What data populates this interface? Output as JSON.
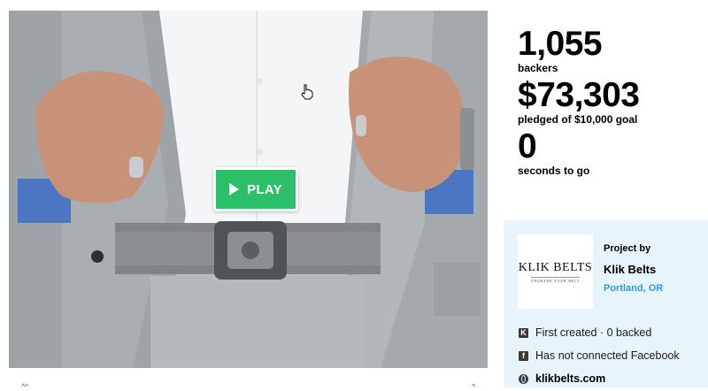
{
  "video": {
    "play_label": "PLAY",
    "bottom_left_mark": "^^",
    "bottom_right_mark": "^"
  },
  "stats": {
    "backers_count": "1,055",
    "backers_label": "backers",
    "pledged_amount": "$73,303",
    "pledged_label": "pledged of $10,000 goal",
    "time_count": "0",
    "time_label": "seconds to go"
  },
  "creator": {
    "logo_text": "KLIK BELTS",
    "logo_tagline": "UPGRADE YOUR BELT",
    "project_by": "Project by",
    "name": "Klik Belts",
    "location": "Portland, OR",
    "first_created": "First created · 0 backed",
    "facebook": "Has not connected Facebook",
    "website": "klikbelts.com"
  },
  "colors": {
    "play_green": "#2bbf68",
    "link_blue": "#2d9bd6",
    "panel_bg": "#e8f4fb"
  },
  "icons": {
    "kickstarter": "kickstarter-icon",
    "facebook": "facebook-icon",
    "website": "globe-icon",
    "cursor": "hand-cursor-icon"
  }
}
